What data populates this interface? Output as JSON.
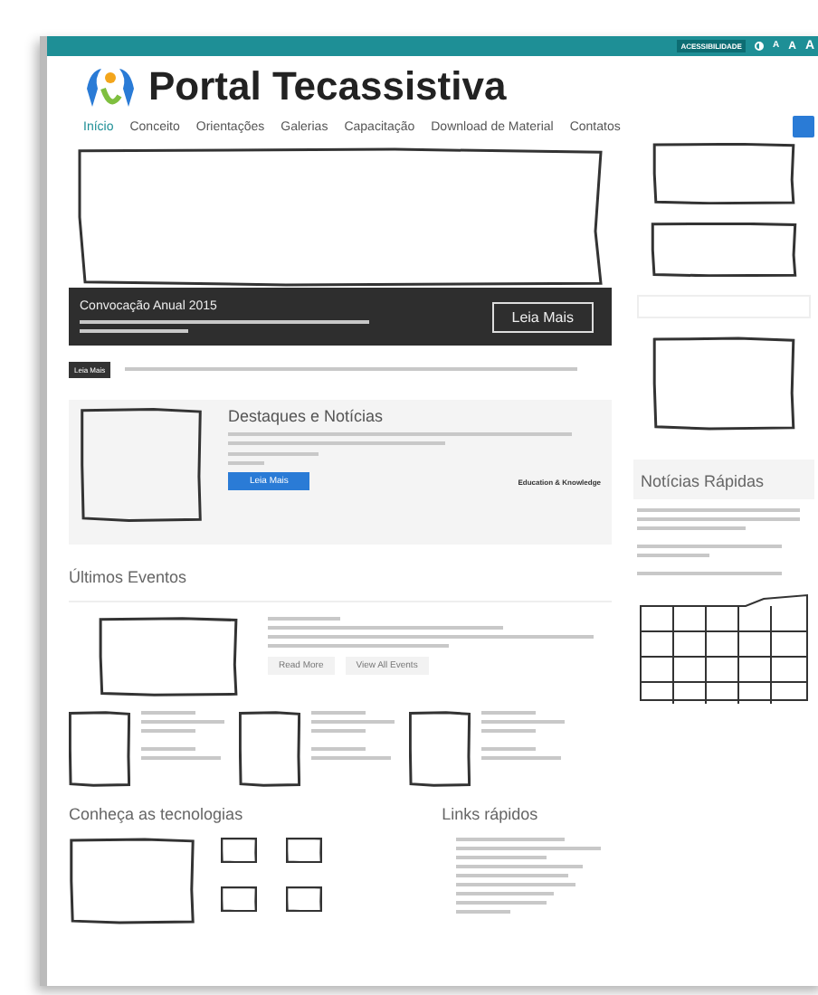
{
  "accessibility": {
    "label": "ACESSIBILIDADE",
    "buttons": [
      "A",
      "A",
      "A"
    ]
  },
  "site": {
    "title": "Portal Tecassistiva"
  },
  "nav": [
    {
      "label": "Início",
      "selected": true
    },
    {
      "label": "Conceito",
      "selected": false
    },
    {
      "label": "Orientações",
      "selected": false
    },
    {
      "label": "Galerias",
      "selected": false
    },
    {
      "label": "Capacitação",
      "selected": false
    },
    {
      "label": "Download de Material",
      "selected": false
    },
    {
      "label": "Contatos",
      "selected": false
    }
  ],
  "slider": {
    "title": "Convocação Anual 2015",
    "button": "Leia Mais"
  },
  "ticker": {
    "tag": "Leia Mais"
  },
  "highlights": {
    "title": "Destaques e Notícias",
    "button": "Leia Mais",
    "partner": "Education & Knowledge"
  },
  "events": {
    "title": "Últimos Eventos",
    "buttons": [
      "Read More",
      "View All Events"
    ]
  },
  "quick_news": {
    "title": "Notícias Rápidas"
  },
  "technologies": {
    "title": "Conheça as tecnologias"
  },
  "links": {
    "title": "Links rápidos"
  }
}
